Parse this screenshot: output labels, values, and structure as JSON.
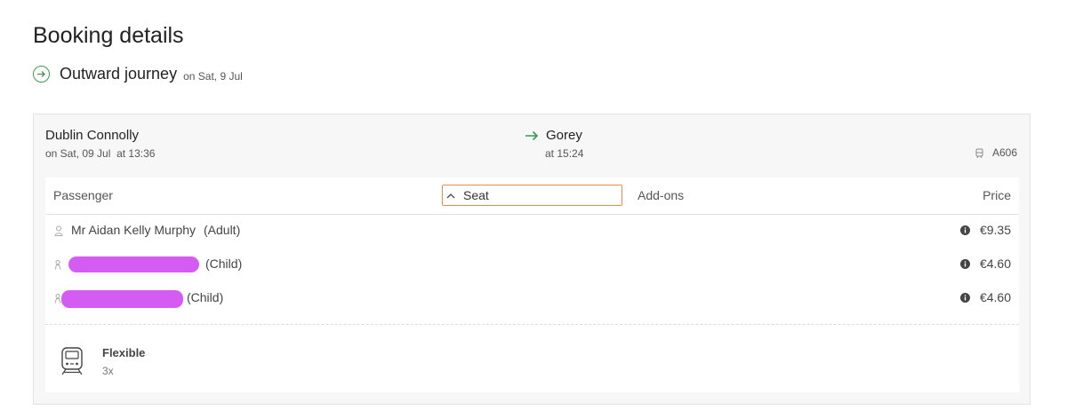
{
  "page": {
    "title": "Booking details"
  },
  "journey": {
    "title": "Outward journey",
    "date": "on Sat, 9 Jul",
    "origin": {
      "station": "Dublin Connolly",
      "date": "on Sat, 09 Jul",
      "time": "at 13:36"
    },
    "destination": {
      "station": "Gorey",
      "time": "at 15:24"
    },
    "train_number": "A606"
  },
  "table": {
    "headers": {
      "passenger": "Passenger",
      "seat": "Seat",
      "addons": "Add-ons",
      "price": "Price"
    },
    "passengers": [
      {
        "name": "Mr Aidan Kelly Murphy",
        "type": "(Adult)",
        "price": "€9.35"
      },
      {
        "name": "",
        "type": "(Child)",
        "price": "€4.60"
      },
      {
        "name": "",
        "type": "(Child)",
        "price": "€4.60"
      }
    ]
  },
  "fare": {
    "name": "Flexible",
    "quantity": "3x"
  },
  "colors": {
    "accent_green": "#3a9a54",
    "focus_orange": "#f08a4b",
    "redaction": "#d45cf2"
  }
}
